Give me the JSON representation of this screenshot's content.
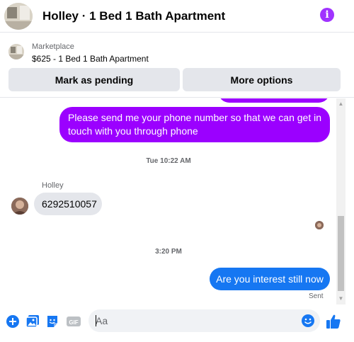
{
  "header": {
    "title": "Holley · 1 Bed 1 Bath Apartment"
  },
  "listing": {
    "kind": "Marketplace",
    "name": "$625 - 1 Bed 1 Bath Apartment",
    "pending_label": "Mark as pending",
    "more_label": "More options"
  },
  "messages": {
    "outgoing_long": "Please send me your phone  number so that we can get in touch with you through phone",
    "time1": "Tue 10:22 AM",
    "sender_name": "Holley",
    "incoming": "6292510057",
    "time2": "3:20 PM",
    "outgoing_last": "Are you interest still now",
    "status": "Sent"
  },
  "composer": {
    "placeholder": "Aa",
    "gif_label": "GIF"
  },
  "colors": {
    "accent_purple": "#9b00ff",
    "accent_blue": "#1677f2",
    "info_purple": "#a033ff"
  }
}
